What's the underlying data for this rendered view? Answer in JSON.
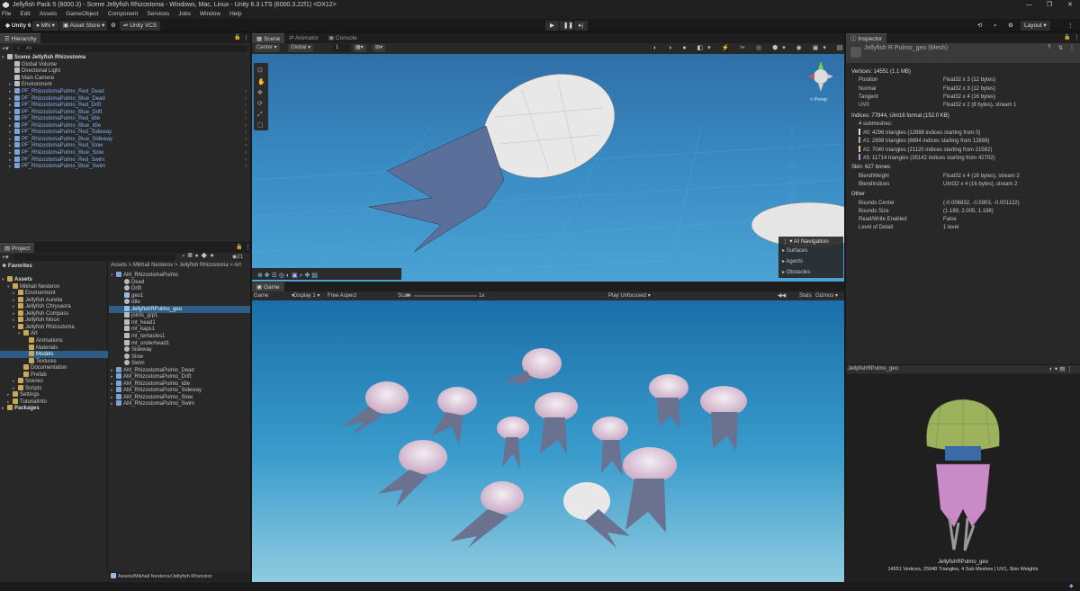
{
  "window": {
    "title": "Jellyfish Pack 5 (6000.3) - Scene Jellyfish Rhizostoma - Windows, Mac, Linux - Unity 6.3 LTS (6000.3.22f1) <DX12>"
  },
  "menu": [
    "File",
    "Edit",
    "Assets",
    "GameObject",
    "Component",
    "Services",
    "Jobs",
    "Window",
    "Help"
  ],
  "toolbar": {
    "unity": "Unity 6",
    "account": "MN",
    "asset_store": "Asset Store",
    "vcs": "Unity VCS",
    "layout": "Layout"
  },
  "hierarchy": {
    "tab": "Hierarchy",
    "search_placeholder": "All",
    "scene": "Scene Jellyfish Rhizostoma",
    "objects": [
      "Global Volume",
      "Directional Light",
      "Main Camera",
      "Environment"
    ],
    "prefabs": [
      "PF_RhizostomaPulmo_Red_Dead",
      "PF_RhizostomaPulmo_Blue_Dead",
      "PF_RhizostomaPulmo_Red_Drift",
      "PF_RhizostomaPulmo_Blue_Drift",
      "PF_RhizostomaPulmo_Red_Idle",
      "PF_RhizostomaPulmo_Blue_Idle",
      "PF_RhizostomaPulmo_Red_Sideway",
      "PF_RhizostomaPulmo_Blue_Sideway",
      "PF_RhizostomaPulmo_Red_Slow",
      "PF_RhizostomaPulmo_Blue_Slow",
      "PF_RhizostomaPulmo_Red_Swim",
      "PF_RhizostomaPulmo_Blue_Swim"
    ]
  },
  "project": {
    "tab": "Project",
    "count": "21",
    "favorites": "Favorites",
    "tree": [
      {
        "t": "Assets",
        "d": 0,
        "bold": true
      },
      {
        "t": "Mikhail Nesterov",
        "d": 1
      },
      {
        "t": "Environment",
        "d": 2
      },
      {
        "t": "Jellyfish Aurelia",
        "d": 2
      },
      {
        "t": "Jellyfish Chrysaora",
        "d": 2
      },
      {
        "t": "Jellyfish Compass",
        "d": 2
      },
      {
        "t": "Jellyfish Moon",
        "d": 2
      },
      {
        "t": "Jellyfish Rhizostoma",
        "d": 2
      },
      {
        "t": "Art",
        "d": 3
      },
      {
        "t": "Animations",
        "d": 4
      },
      {
        "t": "Materials",
        "d": 4
      },
      {
        "t": "Models",
        "d": 4,
        "sel": true
      },
      {
        "t": "Textures",
        "d": 4
      },
      {
        "t": "Documentation",
        "d": 3
      },
      {
        "t": "Prefab",
        "d": 3
      },
      {
        "t": "Scenes",
        "d": 2
      },
      {
        "t": "Scripts",
        "d": 2
      },
      {
        "t": "Settings",
        "d": 1
      },
      {
        "t": "TutorialInfo",
        "d": 1
      },
      {
        "t": "Packages",
        "d": 0,
        "bold": true
      }
    ],
    "breadcrumb": "Assets > Mikhail Nesterov > Jellyfish Rhizostoma > Art",
    "files": [
      {
        "t": "AM_RhizostomaPulmo",
        "d": 0
      },
      {
        "t": "Dead",
        "d": 1
      },
      {
        "t": "Drift",
        "d": 1
      },
      {
        "t": "geo1",
        "d": 1
      },
      {
        "t": "Idle",
        "d": 1
      },
      {
        "t": "JellyfishRPulmo_geo",
        "d": 1,
        "sel": true
      },
      {
        "t": "joints_grp1",
        "d": 1
      },
      {
        "t": "mt_head1",
        "d": 1
      },
      {
        "t": "mt_kaps1",
        "d": 1
      },
      {
        "t": "mt_tentacles1",
        "d": 1
      },
      {
        "t": "mt_underhead1",
        "d": 1
      },
      {
        "t": "Sideway",
        "d": 1
      },
      {
        "t": "Slow",
        "d": 1
      },
      {
        "t": "Swim",
        "d": 1
      },
      {
        "t": "AM_RhizostomaPulmo_Dead",
        "d": 0
      },
      {
        "t": "AM_RhizostomaPulmo_Drift",
        "d": 0
      },
      {
        "t": "AM_RhizostomaPulmo_Idle",
        "d": 0
      },
      {
        "t": "AM_RhizostomaPulmo_Sideway",
        "d": 0
      },
      {
        "t": "AM_RhizostomaPulmo_Slow",
        "d": 0
      },
      {
        "t": "AM_RhizostomaPulmo_Swim",
        "d": 0
      }
    ],
    "path": "Assets/Mikhail Nesterov/Jellyfish Rhizostor"
  },
  "scene": {
    "tabs": [
      "Scene",
      "Animator",
      "Console"
    ],
    "pivot": "Center",
    "space": "Global",
    "snap": "1",
    "persp": "< Persp",
    "ai_nav": {
      "title": "AI Navigation",
      "items": [
        "Surfaces",
        "Agents",
        "Obstacles"
      ]
    }
  },
  "game": {
    "tab": "Game",
    "view": "Game",
    "display": "Display 1",
    "aspect": "Free Aspect",
    "scale_label": "Scale",
    "scale": "1x",
    "play_mode": "Play Unfocused",
    "stats": "Stats",
    "gizmos": "Gizmos"
  },
  "inspector": {
    "tab": "Inspector",
    "asset": "Jellyfish R Pulmo_geo (Mesh)",
    "vertices": "Vertices: 14551 (1.1 MB)",
    "attrs": [
      [
        "Position",
        "Float32 x 3 (12 bytes)"
      ],
      [
        "Normal",
        "Float32 x 3 (12 bytes)"
      ],
      [
        "Tangent",
        "Float32 x 4 (16 bytes)"
      ],
      [
        "UV0",
        "Float32 x 2 (8 bytes), stream 1"
      ]
    ],
    "indices": "Indices: 77844, Uint16 format (152.0 KB)",
    "submeshes_label": "4 submeshes:",
    "submeshes": [
      {
        "t": "#0: 4296 triangles (12888 indices starting from 0)",
        "c": "#e0e0e0"
      },
      {
        "t": "#1: 2898 triangles (8694 indices starting from 12888)",
        "c": "#b0b0b0"
      },
      {
        "t": "#2: 7040 triangles (21120 indices starting from 21582)",
        "c": "#d8d29a"
      },
      {
        "t": "#3: 11714 triangles (35142 indices starting from 42702)",
        "c": "#c58fd8"
      }
    ],
    "skin": "Skin: 627 bones",
    "skin_attrs": [
      [
        "BlendWeight",
        "Float32 x 4 (16 bytes), stream 2"
      ],
      [
        "BlendIndices",
        "UInt32 x 4 (16 bytes), stream 2"
      ]
    ],
    "other": "Other",
    "other_attrs": [
      [
        "Bounds Center",
        "(-0.006832, -0.5903, -0.001122)"
      ],
      [
        "Bounds Size",
        "(1.189, 2.005, 1.198)"
      ],
      [
        "Read/Write Enabled",
        "False"
      ],
      [
        "Level of Detail",
        "1 level"
      ]
    ],
    "preview": {
      "title": "JellyfishRPulmo_geo",
      "name": "JellyfishRPulmo_geo",
      "info": "14551 Vertices, 25948 Triangles, 4 Sub Meshes | UV1, Skin Weights"
    }
  }
}
